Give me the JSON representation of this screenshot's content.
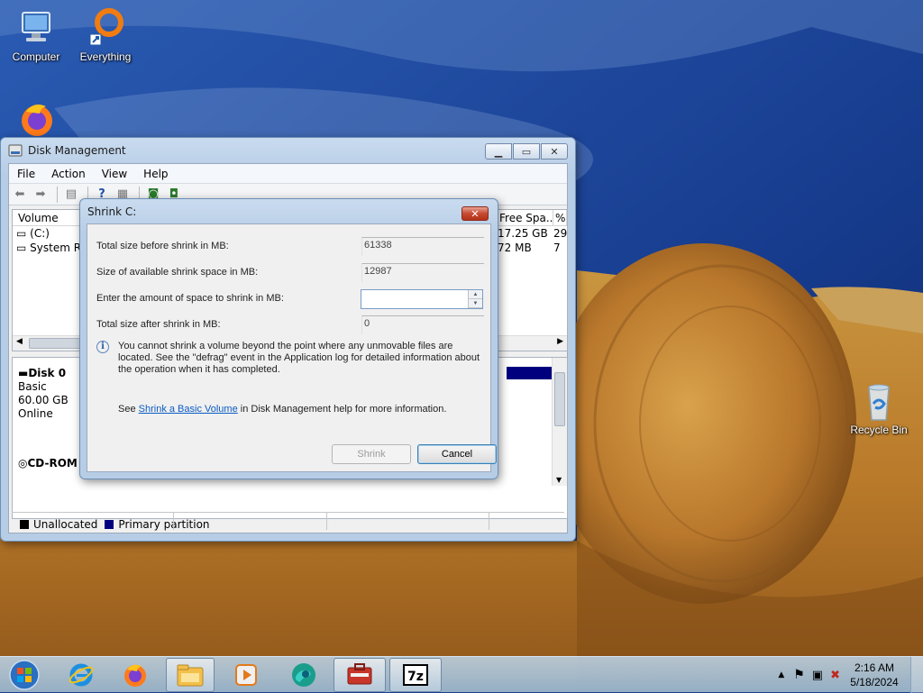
{
  "desktop": {
    "icons": [
      {
        "label": "Computer",
        "icon": "computer-icon"
      },
      {
        "label": "Everything",
        "icon": "everything-icon"
      },
      {
        "label": "",
        "icon": "firefox-icon"
      },
      {
        "label": "Recycle Bin",
        "icon": "recycle-bin-icon"
      }
    ]
  },
  "disk_management": {
    "title": "Disk Management",
    "menu": [
      "File",
      "Action",
      "View",
      "Help"
    ],
    "columns": [
      "Volume",
      "Free Spa...",
      "%"
    ],
    "volumes": [
      {
        "name": "(C:)",
        "free": "17.25 GB",
        "pct": "29"
      },
      {
        "name": "System Re",
        "free": "72 MB",
        "pct": "7"
      }
    ],
    "disks": [
      {
        "name": "Disk 0",
        "type": "Basic",
        "size": "60.00 GB",
        "status": "Online"
      },
      {
        "name": "CD-ROM 0"
      }
    ],
    "legend": [
      {
        "label": "Unallocated",
        "color": "#000000"
      },
      {
        "label": "Primary partition",
        "color": "#00007e"
      }
    ]
  },
  "shrink_dialog": {
    "title": "Shrink C:",
    "rows": [
      {
        "label": "Total size before shrink in MB:",
        "value": "61338"
      },
      {
        "label": "Size of available shrink space in MB:",
        "value": "12987"
      },
      {
        "label": "Enter the amount of space to shrink in MB:",
        "value": ""
      },
      {
        "label": "Total size after shrink in MB:",
        "value": "0"
      }
    ],
    "info": "You cannot shrink a volume beyond the point where any unmovable files are located. See the \"defrag\" event in the Application log for detailed information about the operation when it has completed.",
    "see_prefix": "See ",
    "see_link": "Shrink a Basic Volume",
    "see_suffix": " in Disk Management help for more information.",
    "shrink_button": "Shrink",
    "cancel_button": "Cancel"
  },
  "taskbar": {
    "items": [
      "start-orb-icon",
      "internet-explorer-icon",
      "firefox-icon",
      "file-explorer-icon",
      "media-player-icon",
      "edge-icon",
      "disk-management-icon",
      "7zip-icon"
    ],
    "time": "2:16 AM",
    "date": "5/18/2024"
  },
  "colors": {
    "accent": "#0a5bc4",
    "primary_partition": "#00007e"
  }
}
